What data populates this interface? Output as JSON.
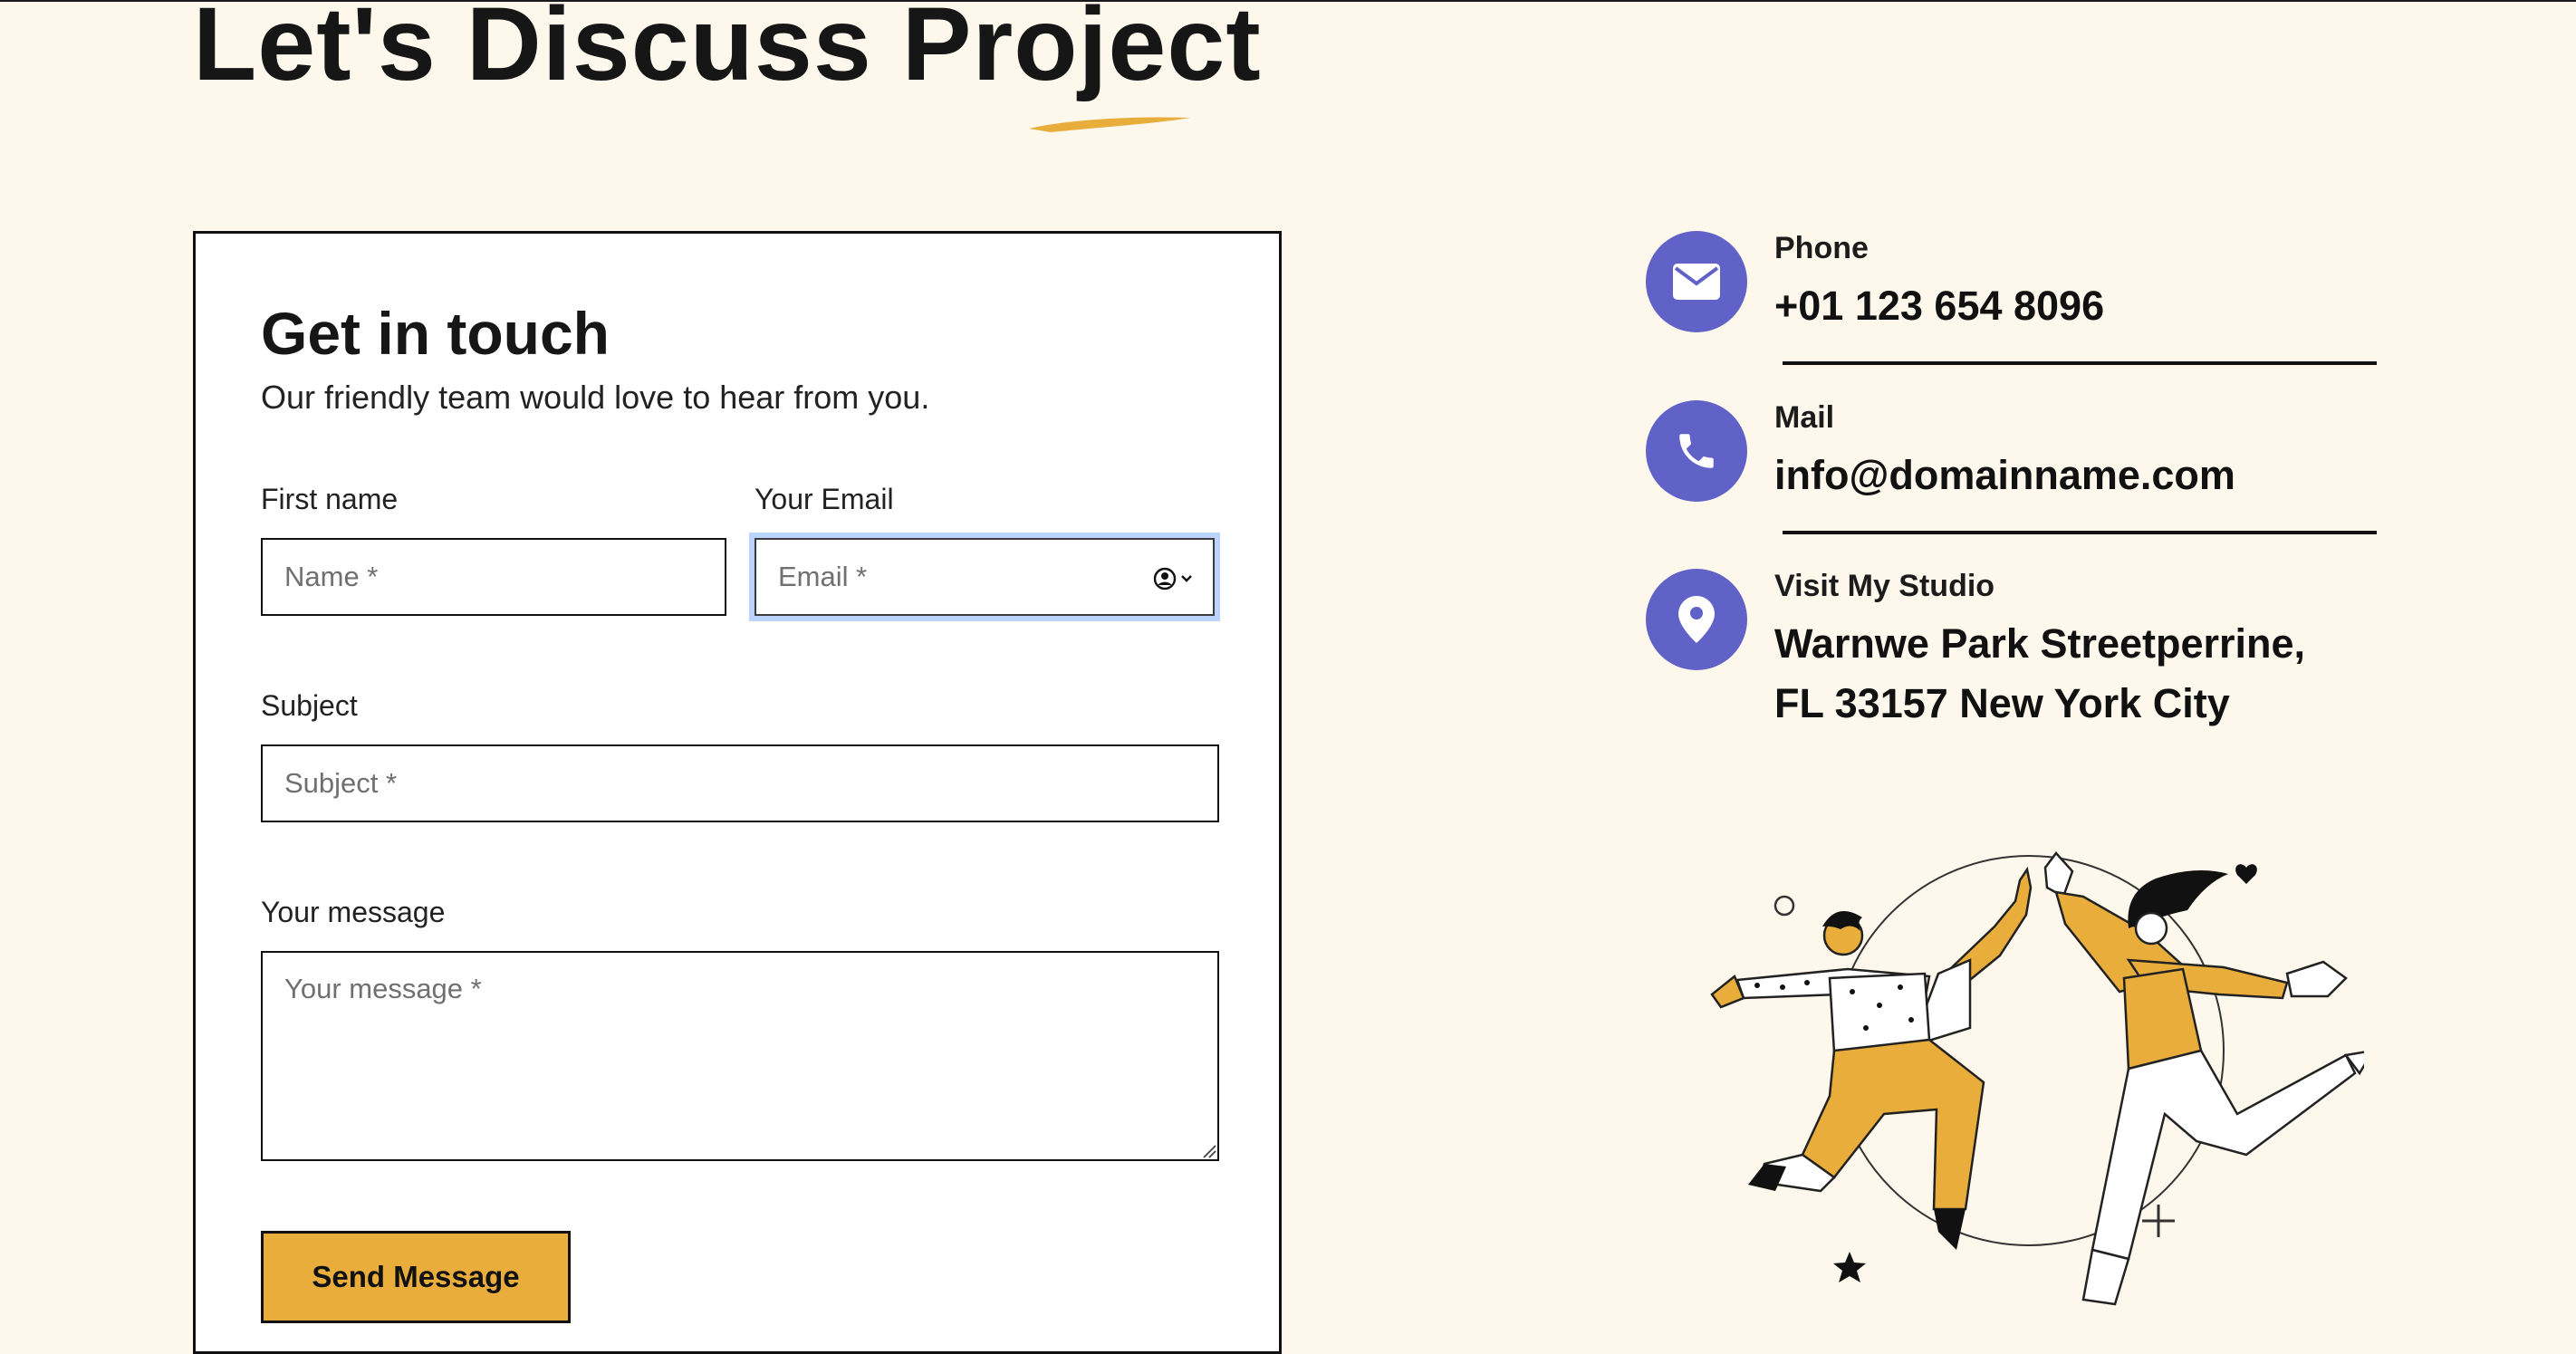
{
  "header": {
    "title": "Let's Discuss Project"
  },
  "form": {
    "title": "Get in touch",
    "subtitle": "Our friendly team would love to hear from you.",
    "first_name": {
      "label": "First name",
      "placeholder": "Name *"
    },
    "email": {
      "label": "Your Email",
      "placeholder": "Email *"
    },
    "subject": {
      "label": "Subject",
      "placeholder": "Subject *"
    },
    "message": {
      "label": "Your message",
      "placeholder": "Your message *"
    },
    "submit_label": "Send Message"
  },
  "contact": {
    "items": [
      {
        "label": "Phone",
        "value": "+01 123 654 8096",
        "icon": "envelope-icon"
      },
      {
        "label": "Mail",
        "value": "info@domainname.com",
        "icon": "phone-icon"
      },
      {
        "label": "Visit My Studio",
        "value_line1": "Warnwe Park Streetperrine,",
        "value_line2": "FL 33157 New York City",
        "icon": "location-pin-icon"
      }
    ]
  },
  "colors": {
    "background": "#fdf7ec",
    "accent": "#e9ad3c",
    "icon_circle": "#6162c8",
    "focus_ring": "#bcd2ff"
  }
}
